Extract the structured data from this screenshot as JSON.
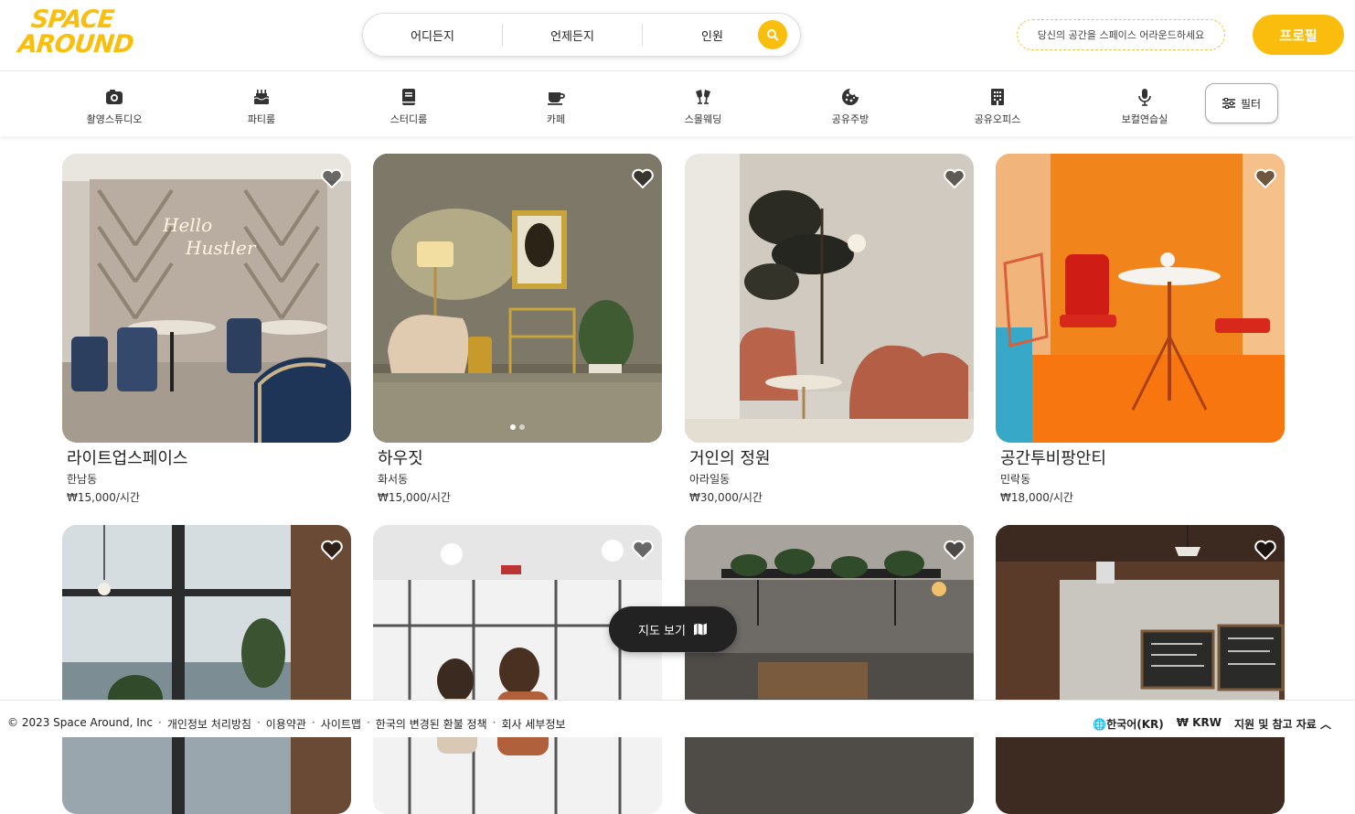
{
  "header": {
    "logo_line1": "SPACE",
    "logo_line2": "AROUND",
    "search": {
      "where": "어디든지",
      "when": "언제든지",
      "guests": "인원"
    },
    "tagline": "당신의 공간을 스페이스 어라운드하세요",
    "profile_label": "프로필"
  },
  "categories": [
    {
      "label": "촬영스튜디오",
      "icon": "camera-icon"
    },
    {
      "label": "파티룸",
      "icon": "cake-icon"
    },
    {
      "label": "스터디룸",
      "icon": "book-icon"
    },
    {
      "label": "카페",
      "icon": "coffee-cup-icon"
    },
    {
      "label": "스몰웨딩",
      "icon": "wedding-glasses-icon"
    },
    {
      "label": "공유주방",
      "icon": "cookie-icon"
    },
    {
      "label": "공유오피스",
      "icon": "building-icon"
    },
    {
      "label": "보컬연습실",
      "icon": "microphone-icon"
    }
  ],
  "filter_label": "필터",
  "listings": [
    {
      "title": "라이트업스페이스",
      "location": "한남동",
      "price": "₩15,000/시간"
    },
    {
      "title": "하우짓",
      "location": "화서동",
      "price": "₩15,000/시간"
    },
    {
      "title": "거인의 정원",
      "location": "아라일동",
      "price": "₩30,000/시간"
    },
    {
      "title": "공간투비팡안티",
      "location": "민락동",
      "price": "₩18,000/시간"
    },
    {
      "title": "",
      "location": "",
      "price": ""
    },
    {
      "title": "",
      "location": "",
      "price": ""
    },
    {
      "title": "",
      "location": "",
      "price": ""
    },
    {
      "title": "",
      "location": "",
      "price": ""
    }
  ],
  "map_button_label": "지도 보기",
  "footer": {
    "copyright": "© 2023 Space Around, Inc",
    "links": [
      "개인정보 처리방침",
      "이용약관",
      "사이트맵",
      "한국의 변경된 환불 정책",
      "회사 세부정보"
    ],
    "language": "한국어(KR)",
    "currency": "₩ KRW",
    "support": "지원 및 참고 자료"
  },
  "colors": {
    "accent": "#fbbd0d",
    "logo": "#f9bf0f",
    "map_button": "#222222"
  }
}
